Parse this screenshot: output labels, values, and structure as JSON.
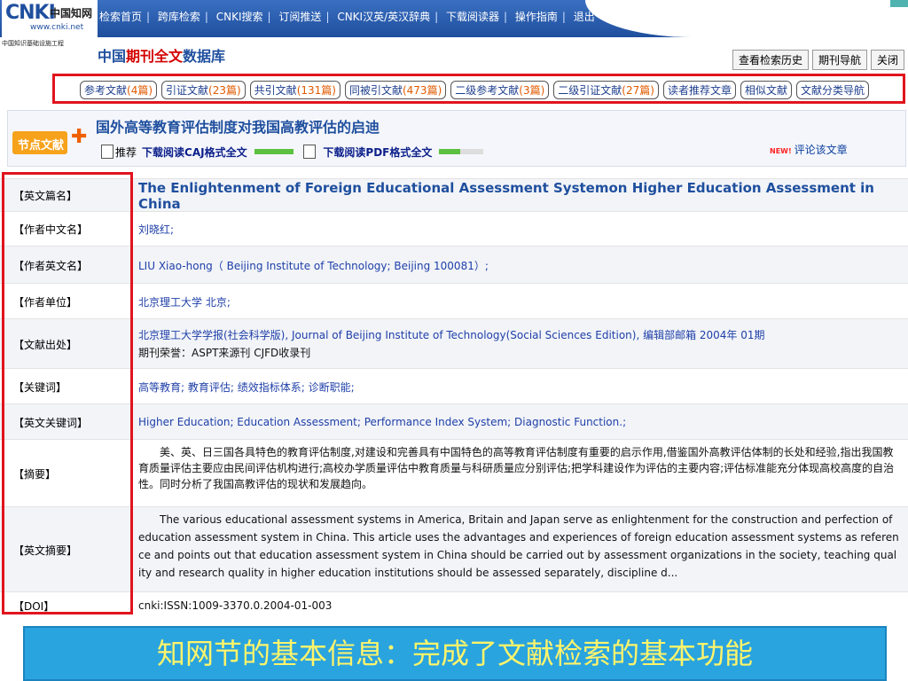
{
  "logo": {
    "main": "CNKI",
    "cn": "中国知网",
    "url": "www.cnki.net",
    "caption": "中国知识基础设施工程"
  },
  "nav": [
    "检索首页",
    "跨库检索",
    "CNKI搜索",
    "订阅推送",
    "CNKI汉英/英汉辞典",
    "下载阅读器",
    "操作指南",
    "退出"
  ],
  "db_title": {
    "pre": "中国",
    "red": "期刊全文",
    "post": "数据库"
  },
  "right_buttons": [
    "查看检索历史",
    "期刊导航",
    "关闭"
  ],
  "links": [
    {
      "label": "参考文献",
      "count": "(4篇)"
    },
    {
      "label": "引证文献",
      "count": "(23篇)"
    },
    {
      "label": "共引文献",
      "count": "(131篇)"
    },
    {
      "label": "同被引文献",
      "count": "(473篇)"
    },
    {
      "label": "二级参考文献",
      "count": "(3篇)"
    },
    {
      "label": "二级引证文献",
      "count": "(27篇)"
    },
    {
      "label": "读者推荐文章",
      "count": ""
    },
    {
      "label": "相似文献",
      "count": ""
    },
    {
      "label": "文献分类导航",
      "count": ""
    }
  ],
  "article": {
    "badge": "节点文献",
    "title": "国外高等教育评估制度对我国高教评估的启迪",
    "recommend": "推荐",
    "caj": "下载阅读CAJ格式全文",
    "pdf": "下载阅读PDF格式全文",
    "new_tag": "NEW!",
    "comment": "评论该文章"
  },
  "colors": {
    "nav_bg": "#1f4f9e",
    "highlight_box": "#e0141e",
    "banner_bg": "#2aa4df",
    "banner_text": "#fff46a"
  },
  "fields": {
    "en_title": {
      "label": "【英文篇名】",
      "value": "The Enlightenment of Foreign Educational Assessment Systemon Higher Education Assessment in China"
    },
    "author_cn": {
      "label": "【作者中文名】",
      "value": "刘晓红;"
    },
    "author_en": {
      "label": "【作者英文名】",
      "value": "LIU Xiao-hong（ Beijing Institute of Technology; Beijing 100081）;"
    },
    "org": {
      "label": "【作者单位】",
      "value": "北京理工大学 北京;"
    },
    "source": {
      "label": "【文献出处】",
      "value": "北京理工大学学报(社会科学版), Journal of Beijing Institute of Technology(Social Sciences Edition), 编辑部邮箱 2004年 01期",
      "line2": "期刊荣誉：ASPT来源刊 CJFD收录刊"
    },
    "keywords": {
      "label": "【关键词】",
      "value": "高等教育; 教育评估; 绩效指标体系; 诊断职能;"
    },
    "en_keywords": {
      "label": "【英文关键词】",
      "value": "Higher Education; Education Assessment; Performance Index System; Diagnostic Function.;"
    },
    "abstract": {
      "label": "【摘要】",
      "value": "美、英、日三国各具特色的教育评估制度,对建设和完善具有中国特色的高等教育评估制度有重要的启示作用,借鉴国外高教评估体制的长处和经验,指出我国教育质量评估主要应由民间评估机构进行;高校办学质量评估中教育质量与科研质量应分别评估;把学科建设作为评估的主要内容;评估标准能充分体现高校高度的自治性。同时分析了我国高教评估的现状和发展趋向。"
    },
    "en_abstract": {
      "label": "【英文摘要】",
      "value": "The various educational assessment systems in America, Britain and Japan serve as enlightenment for the construction and perfection of education assessment system in China. This article uses the advantages and experiences of foreign education assessment systems as reference and points out that education assessment system in China should be carried out by assessment organizations in the society, teaching quality and research quality in higher education institutions should be assessed separately, discipline d..."
    },
    "doi": {
      "label": "【DOI】",
      "value": "cnki:ISSN:1009-3370.0.2004-01-003"
    }
  },
  "banner": "知网节的基本信息：完成了文献检索的基本功能"
}
